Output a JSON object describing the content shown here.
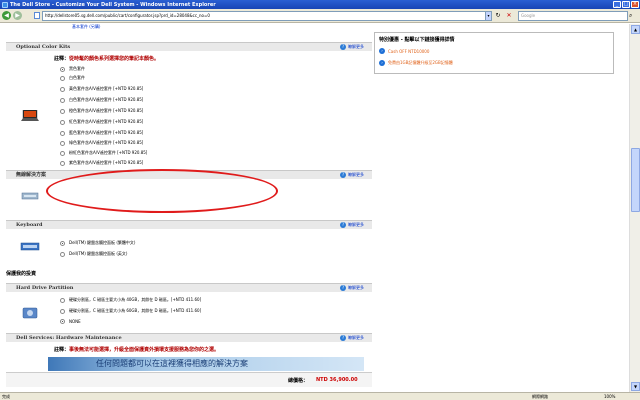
{
  "window": {
    "title": "The Dell Store - Customize Your Dell System - Windows Internet Explorer"
  },
  "addressbar": {
    "url": "http://dellstore05.sg.dell.com/public/cart/configurator.jsp?prd_id=28048&cc_no=0",
    "search_placeholder": "Google"
  },
  "top_link": "基本套件 (另購)",
  "sections": {
    "color_kits": {
      "title": "Optional Color Kits",
      "more_label": "瞭解更多",
      "note_label": "註釋：",
      "note_text": "從時髦的顏色系列選擇您的筆記本顏色。",
      "options": [
        "黑色套件",
        "白色套件",
        "黃色套件含A/V遙控套件 [+NTD 920.85]",
        "白色套件含A/V遙控套件 [+NTD 920.85]",
        "橙色套件含A/V遙控套件 [+NTD 920.85]",
        "紅色套件含A/V遙控套件 [+NTD 920.85]",
        "藍色套件含A/V遙控套件 [+NTD 920.85]",
        "綠色套件含A/V遙控套件 [+NTD 920.85]",
        "粉紅色套件含A/V遙控套件 [+NTD 920.85]",
        "紫色套件含A/V遙控套件 [+NTD 920.85]"
      ]
    },
    "wireless": {
      "title": "無線解決方案",
      "more_label": "瞭解更多"
    },
    "keyboard": {
      "title": "Keyboard",
      "more_label": "瞭解更多",
      "options": [
        "Dell(TM) 鍵盤含觸控面板 (繁體中文)",
        "Dell(TM) 鍵盤含觸控面板 (英文)"
      ]
    },
    "protect_heading": "保護我的投資",
    "hdd_partition": {
      "title": "Hard Drive Partition",
      "more_label": "瞭解更多",
      "options": [
        "硬碟分割區，C 磁區主要大小為 40GB，其餘在 D 磁區。[+NTD 411.60]",
        "硬碟分割區，C 磁區主要大小為 60GB，其餘在 D 磁區。[+NTD 411.60]",
        "NONE"
      ]
    },
    "services": {
      "title": "Dell Services: Hardware Maintenance",
      "more_label": "瞭解更多",
      "note_label": "註釋：",
      "note_text": "事後無法可能選擇，升級全面保護資外損壞支援服務為您你的之選。"
    }
  },
  "banner_text": "任何問題都可以在這裡獲得相應的解決方案",
  "price": {
    "label": "總價格：",
    "value": "NTD 36,900.00"
  },
  "side": {
    "title": "特別優惠 - 點擊以下鏈接獲得詳情",
    "items": [
      "Cash OFF NTD10000",
      "免費由1GB記憶體升級至2GB記憶體"
    ]
  },
  "status": {
    "left": "完成",
    "zone": "網際網路",
    "zoom": "100%"
  }
}
